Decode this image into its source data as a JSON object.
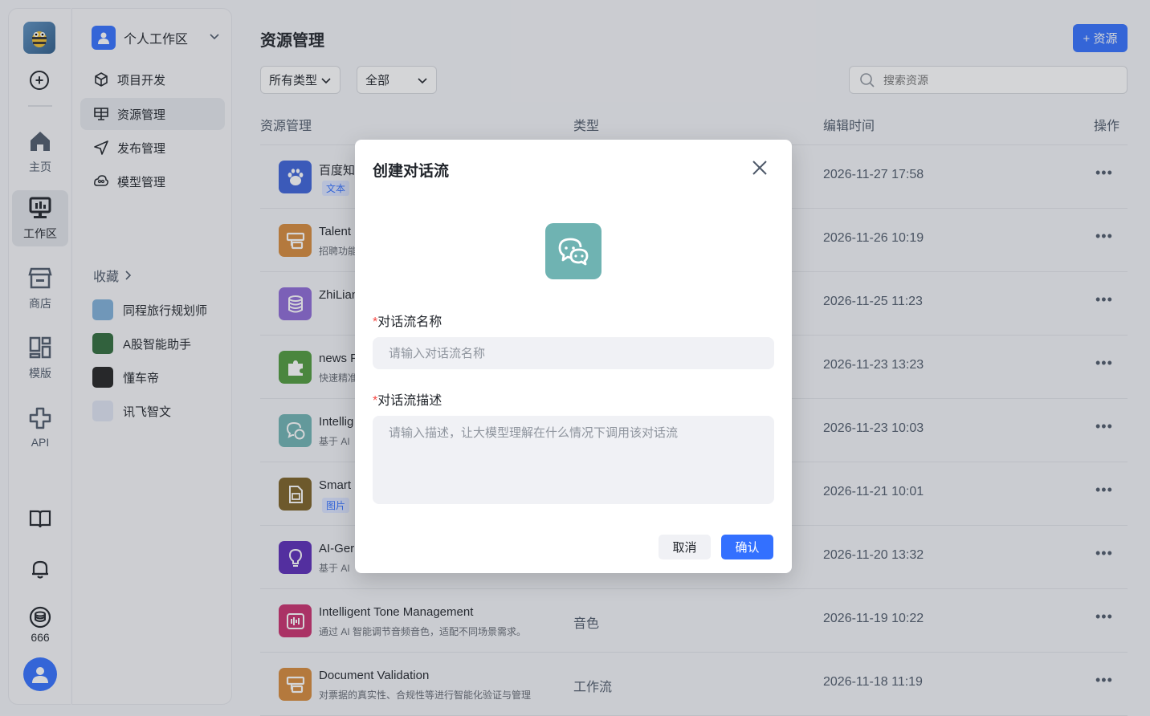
{
  "rail": {
    "items": [
      {
        "label": "主页",
        "icon": "home-icon"
      },
      {
        "label": "工作区",
        "icon": "monitor-icon"
      },
      {
        "label": "商店",
        "icon": "store-icon"
      },
      {
        "label": "模版",
        "icon": "template-icon"
      },
      {
        "label": "API",
        "icon": "api-icon"
      }
    ],
    "coins": "666"
  },
  "sidebar": {
    "workspace": "个人工作区",
    "nav": [
      {
        "label": "项目开发",
        "icon": "cube-icon"
      },
      {
        "label": "资源管理",
        "icon": "grid-icon"
      },
      {
        "label": "发布管理",
        "icon": "send-icon"
      },
      {
        "label": "模型管理",
        "icon": "cloud-brain-icon"
      }
    ],
    "favorites_title": "收藏",
    "favorites": [
      {
        "label": "同程旅行规划师",
        "color": "#7fb0d9"
      },
      {
        "label": "A股智能助手",
        "color": "#2f6b3a"
      },
      {
        "label": "懂车帝",
        "color": "#222222"
      },
      {
        "label": "讯飞智文",
        "color": "#dfe4f2"
      }
    ]
  },
  "main": {
    "title": "资源管理",
    "add_button": "+ 资源",
    "filter_type": "所有类型",
    "filter_scope": "全部",
    "search_placeholder": "搜索资源",
    "columns": {
      "name": "资源管理",
      "type": "类型",
      "time": "编辑时间",
      "action": "操作"
    },
    "rows": [
      {
        "name": "百度知",
        "tag": "文本",
        "desc": "",
        "type": "",
        "time": "2026-11-27 17:58",
        "color": "#3b62d9",
        "icon": "baidu-icon"
      },
      {
        "name": "Talent",
        "tag": "",
        "desc": "招聘功能",
        "type": "",
        "time": "2026-11-26 10:19",
        "color": "#d68a3a",
        "icon": "workflow-icon"
      },
      {
        "name": "ZhiLian",
        "tag": "",
        "desc": "",
        "type": "",
        "time": "2026-11-25 11:23",
        "color": "#8e69d6",
        "icon": "database-icon"
      },
      {
        "name": "news F",
        "tag": "",
        "desc": "快速精准",
        "type": "",
        "time": "2026-11-23 13:23",
        "color": "#4f9a3c",
        "icon": "puzzle-icon"
      },
      {
        "name": "Intellig",
        "tag": "",
        "desc": "基于 AI",
        "type": "",
        "time": "2026-11-23 10:03",
        "color": "#6fb3b2",
        "icon": "chat-icon"
      },
      {
        "name": "Smart",
        "tag": "图片",
        "desc": "",
        "type": "",
        "time": "2026-11-21 10:01",
        "color": "#7b6025",
        "icon": "image-file-icon"
      },
      {
        "name": "AI-Ger",
        "tag": "",
        "desc": "基于 AI",
        "type": "",
        "time": "2026-11-20 13:32",
        "color": "#5a2bb8",
        "icon": "bulb-icon"
      },
      {
        "name": "Intelligent Tone Management",
        "tag": "",
        "desc": "通过 AI 智能调节音频音色，适配不同场景需求。",
        "type": "音色",
        "time": "2026-11-19 10:22",
        "color": "#c92f6e",
        "icon": "waveform-icon"
      },
      {
        "name": "Document Validation",
        "tag": "",
        "desc": "对票据的真实性、合规性等进行智能化验证与管理",
        "type": "工作流",
        "time": "2026-11-18 11:19",
        "color": "#d68a3a",
        "icon": "workflow-icon"
      }
    ]
  },
  "modal": {
    "title": "创建对话流",
    "name_label": "对话流名称",
    "name_placeholder": "请输入对话流名称",
    "desc_label": "对话流描述",
    "desc_placeholder": "请输入描述，让大模型理解在什么情况下调用该对话流",
    "required_mark": "*",
    "cancel": "取消",
    "confirm": "确认",
    "icon_color": "#6fb3b2"
  }
}
